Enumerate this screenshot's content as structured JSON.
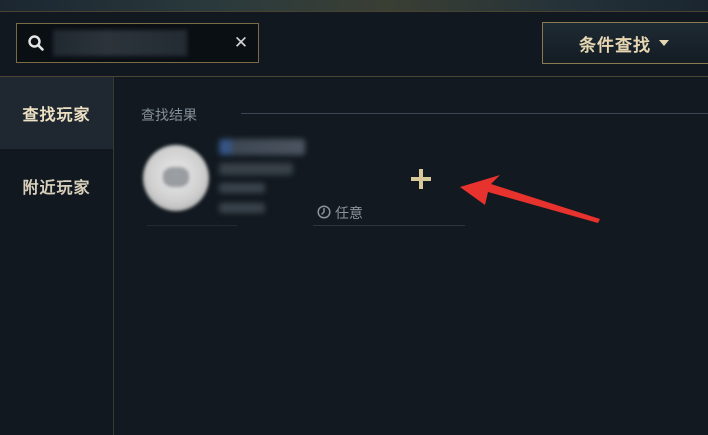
{
  "header": {
    "search": {
      "value": "",
      "placeholder": "",
      "clear_label": "✕"
    },
    "filter_button": {
      "label": "条件查找"
    }
  },
  "sidebar": {
    "tabs": [
      {
        "label": "查找玩家",
        "active": true
      },
      {
        "label": "附近玩家",
        "active": false
      }
    ]
  },
  "main": {
    "section_title": "查找结果",
    "result": {
      "status": "任意",
      "add_label": "+"
    }
  },
  "colors": {
    "accent_gold": "#e6d7b2",
    "border_gold": "#7a6a45",
    "annotation_arrow": "#e8322d"
  }
}
